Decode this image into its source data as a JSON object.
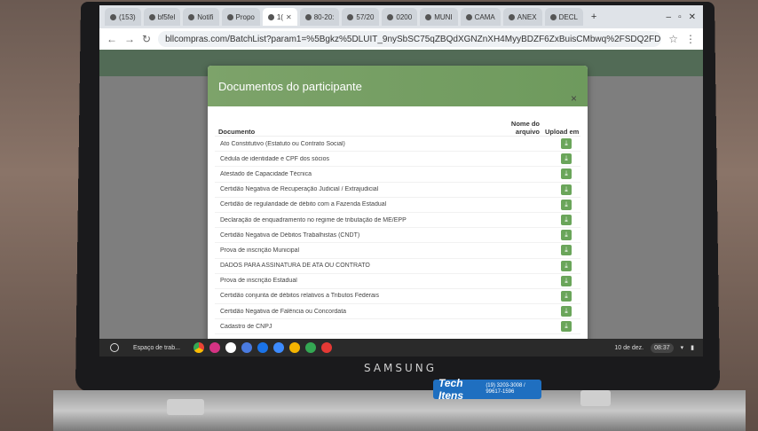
{
  "browser": {
    "tabs": [
      {
        "label": "(153)",
        "active": false
      },
      {
        "label": "bf5fel",
        "active": false
      },
      {
        "label": "Notifi",
        "active": false
      },
      {
        "label": "Propo",
        "active": false
      },
      {
        "label": "1(",
        "active": true
      },
      {
        "label": "80-20:",
        "active": false
      },
      {
        "label": "57/20",
        "active": false
      },
      {
        "label": "0200",
        "active": false
      },
      {
        "label": "MUNI",
        "active": false
      },
      {
        "label": "CAMA",
        "active": false
      },
      {
        "label": "ANEX",
        "active": false
      },
      {
        "label": "DECL",
        "active": false
      }
    ],
    "new_tab": "+",
    "url": "bllcompras.com/BatchList?param1=%5Bgkz%5DLUIT_9nySbSC75qZBQdXGNZnXH4MyyBDZF6ZxBuisCMbwq%2FSDQ2FDBaaqVHXY0gxz0gSt..."
  },
  "modal": {
    "title": "Documentos do participante",
    "close": "×",
    "columns": {
      "document": "Documento",
      "filename": "Nome do arquivo",
      "upload": "Upload em"
    },
    "rows": [
      "Ato Constitutivo (Estatuto ou Contrato Social)",
      "Cédula de identidade e CPF dos sócios",
      "Atestado de Capacidade Técnica",
      "Certidão Negativa de Recuperação Judicial / Extrajudicial",
      "Certidão de regularidade de débito com a Fazenda Estadual",
      "Declaração de enquadramento no regime de tributação de ME/EPP",
      "Certidão Negativa de Débitos Trabalhistas (CNDT)",
      "Prova de inscrição Municipal",
      "DADOS PARA ASSINATURA DE ATA OU CONTRATO",
      "Prova de inscrição Estadual",
      "Certidão conjunta de débitos relativos a Tributos Federais",
      "Certidão Negativa de Falência ou Concordata",
      "Cadastro de CNPJ"
    ]
  },
  "shelf": {
    "search": "Espaço de trab...",
    "date": "10 de dez.",
    "time": "08:37"
  },
  "device": {
    "brand": "SAMSUNG",
    "sticker": "Tech Itens",
    "sticker_phone": "(19) 3203-3008 / 99617-1596"
  }
}
